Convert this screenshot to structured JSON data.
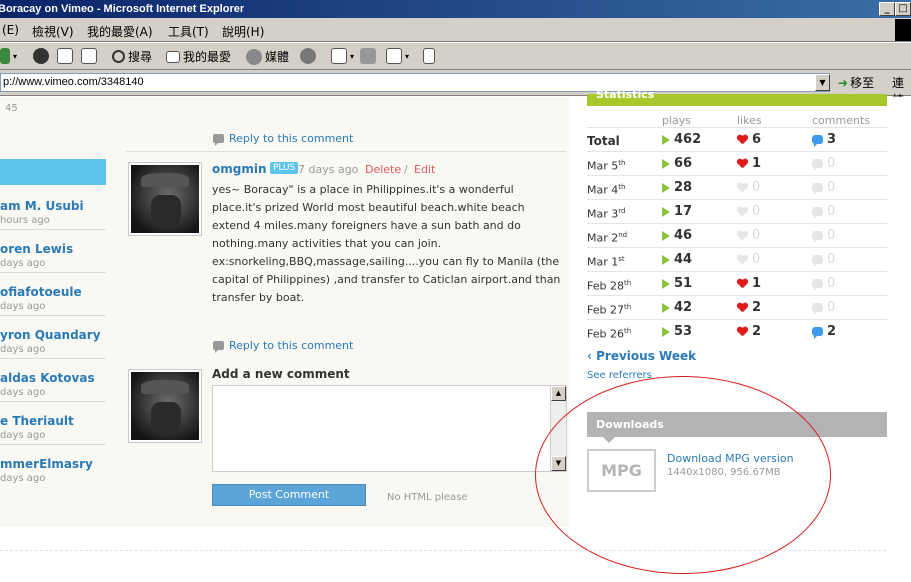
{
  "window": {
    "title": "Boracay on Vimeo - Microsoft Internet Explorer"
  },
  "menu": [
    "(E)",
    "檢視(V)",
    "我的最愛(A)",
    "工具(T)",
    "說明(H)"
  ],
  "toolbar": {
    "search_label": "搜尋",
    "favorites_label": "我的最愛",
    "media_label": "媒體"
  },
  "address": {
    "url": "p://www.vimeo.com/3348140",
    "go_label": "移至",
    "links_label": "連結"
  },
  "page": {
    "top_count": "45",
    "subscribers": [
      {
        "name": "am M. Usubi",
        "time": "hours ago"
      },
      {
        "name": "oren Lewis",
        "time": "days ago"
      },
      {
        "name": "ofiafotoeule",
        "time": "days ago"
      },
      {
        "name": "yron Quandary",
        "time": "days ago"
      },
      {
        "name": "aldas Kotovas",
        "time": "days ago"
      },
      {
        "name": "e Theriault",
        "time": "days ago"
      },
      {
        "name": "mmerElmasry",
        "time": "days ago"
      }
    ],
    "reply_label_top": "Reply to this comment",
    "comment": {
      "author": "omgmin",
      "badge": "PLUS",
      "time": "7 days ago",
      "delete_label": "Delete",
      "separator": "/",
      "edit_label": "Edit",
      "body": "yes~ Boracay\" is a place in Philippines.it's a wonderful place.it's prized World most beautiful beach.white beach extend 4 miles.many foreigners have a sun bath and do nothing.many activities that you can join. ex:snorkeling,BBQ,massage,sailing....you can fly to Manila (the capital of Philippines) ,and transfer to Caticlan airport.and than transfer by boat."
    },
    "reply_label_bottom": "Reply to this comment",
    "add_comment_title": "Add a new comment",
    "post_button": "Post Comment",
    "no_html": "No HTML please"
  },
  "stats": {
    "header": "Statistics",
    "columns": [
      "plays",
      "likes",
      "comments"
    ],
    "rows": [
      {
        "label": "Total",
        "sup": "",
        "plays": "462",
        "likes": "6",
        "comments": "3"
      },
      {
        "label": "Mar 5",
        "sup": "th",
        "plays": "66",
        "likes": "1",
        "comments": "0"
      },
      {
        "label": "Mar 4",
        "sup": "th",
        "plays": "28",
        "likes": "0",
        "comments": "0"
      },
      {
        "label": "Mar 3",
        "sup": "rd",
        "plays": "17",
        "likes": "0",
        "comments": "0"
      },
      {
        "label": "Mar 2",
        "sup": "nd",
        "plays": "46",
        "likes": "0",
        "comments": "0"
      },
      {
        "label": "Mar 1",
        "sup": "st",
        "plays": "44",
        "likes": "0",
        "comments": "0"
      },
      {
        "label": "Feb 28",
        "sup": "th",
        "plays": "51",
        "likes": "1",
        "comments": "0"
      },
      {
        "label": "Feb 27",
        "sup": "th",
        "plays": "42",
        "likes": "2",
        "comments": "0"
      },
      {
        "label": "Feb 26",
        "sup": "th",
        "plays": "53",
        "likes": "2",
        "comments": "2"
      }
    ],
    "prev_week": "Previous Week",
    "see_referrers": "See referrers"
  },
  "downloads": {
    "header": "Downloads",
    "format_icon": "MPG",
    "link": "Download MPG version",
    "meta": "1440x1080, 956.67MB"
  },
  "colors": {
    "link": "#2a7ab7",
    "accent_green": "#a6c82a",
    "accent_blue": "#5bc4ec",
    "annotation_red": "#d51e1e"
  }
}
